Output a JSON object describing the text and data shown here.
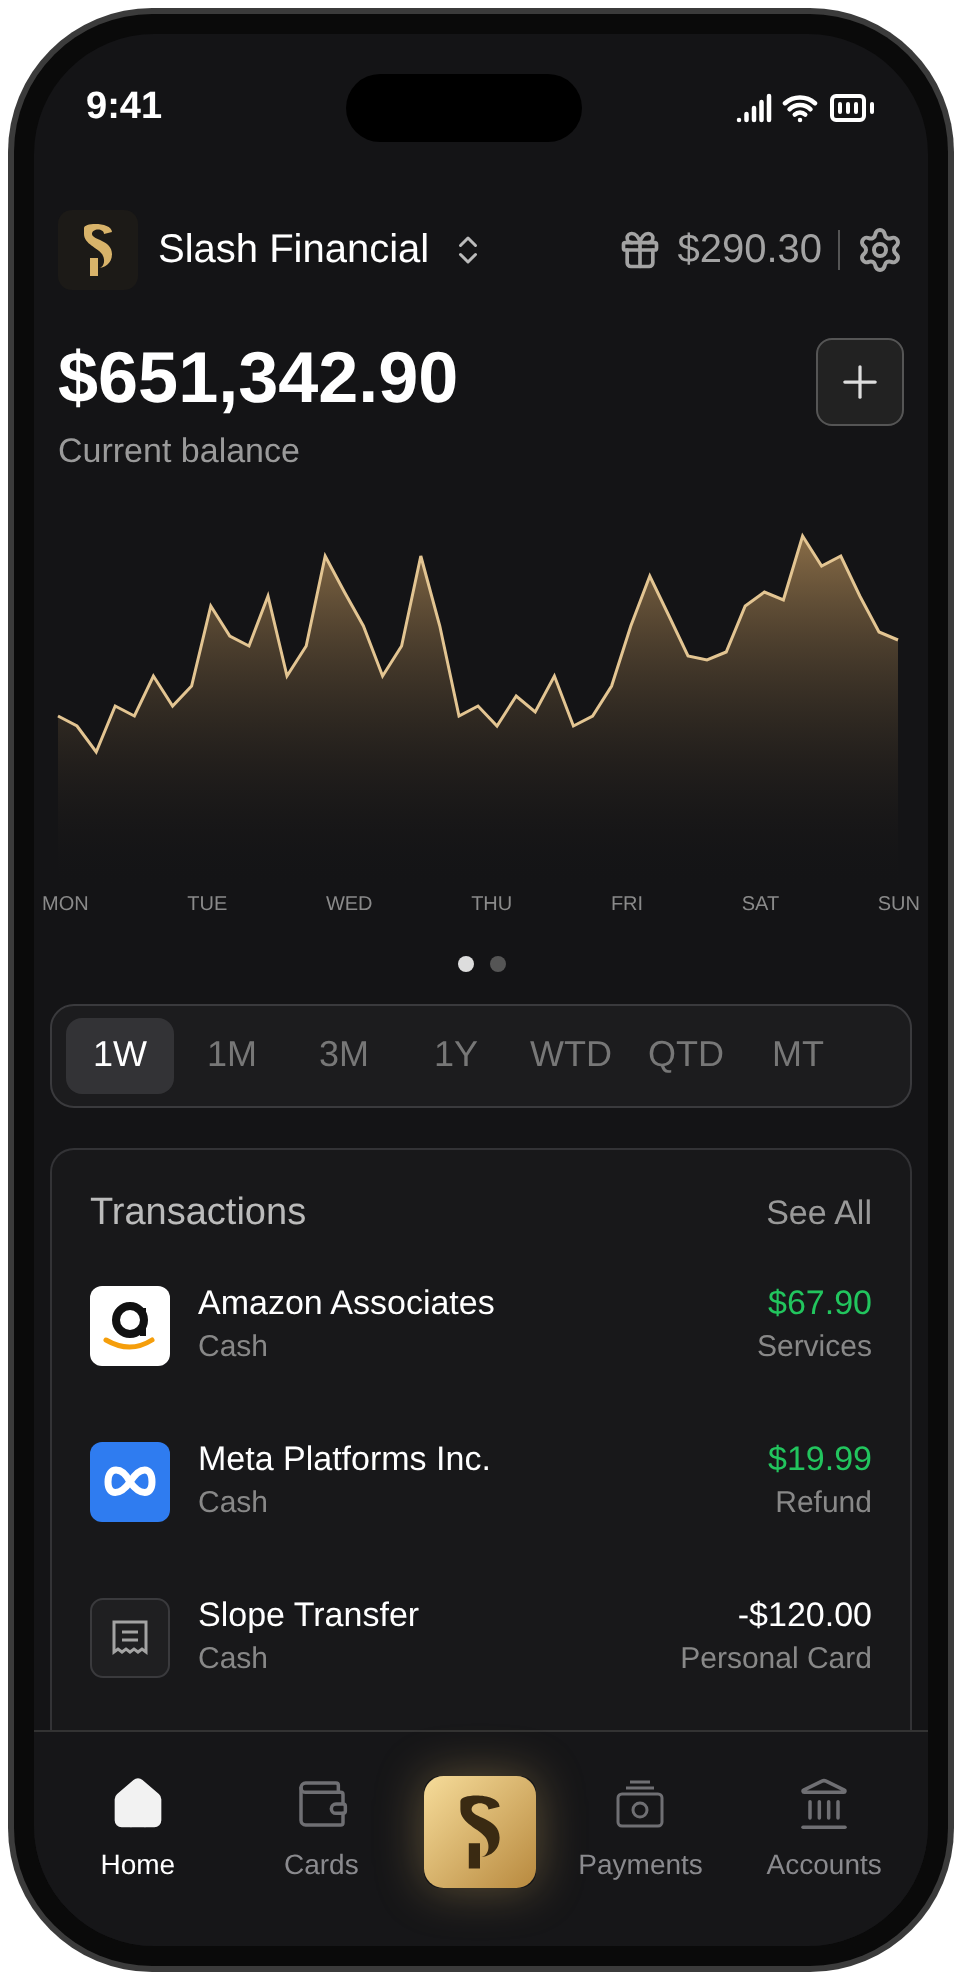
{
  "status_bar": {
    "time": "9:41"
  },
  "header": {
    "org": "Slash Financial",
    "rewards": "$290.30"
  },
  "balance": {
    "amount": "$651,342.90",
    "label": "Current balance"
  },
  "chart": {
    "days": [
      "MON",
      "TUE",
      "WED",
      "THU",
      "FRI",
      "SAT",
      "SUN"
    ],
    "pages": [
      {
        "selected": true
      },
      {
        "selected": false
      }
    ]
  },
  "ranges": [
    {
      "label": "1W",
      "selected": true
    },
    {
      "label": "1M",
      "selected": false
    },
    {
      "label": "3M",
      "selected": false
    },
    {
      "label": "1Y",
      "selected": false
    },
    {
      "label": "WTD",
      "selected": false
    },
    {
      "label": "QTD",
      "selected": false
    },
    {
      "label": "MT",
      "selected": false
    }
  ],
  "transactions": {
    "title": "Transactions",
    "see_all": "See All",
    "items": [
      {
        "kind": "smile-logo",
        "name": "Amazon Associates",
        "account": "Cash",
        "amount": "$67.90",
        "positive": true,
        "category": "Services"
      },
      {
        "kind": "infinity-logo",
        "name": "Meta Platforms Inc.",
        "account": "Cash",
        "amount": "$19.99",
        "positive": true,
        "category": "Refund"
      },
      {
        "kind": "receipt",
        "name": "Slope Transfer",
        "account": "Cash",
        "amount": "-$120.00",
        "positive": false,
        "category": "Personal Card"
      }
    ]
  },
  "tab_bar": [
    {
      "kind": "home",
      "label": "Home",
      "selected": true
    },
    {
      "kind": "wallet",
      "label": "Cards",
      "selected": false
    },
    {
      "kind": "logo",
      "selected": false
    },
    {
      "kind": "payments",
      "label": "Payments",
      "selected": false
    },
    {
      "kind": "bank",
      "label": "Accounts",
      "selected": false
    }
  ]
}
